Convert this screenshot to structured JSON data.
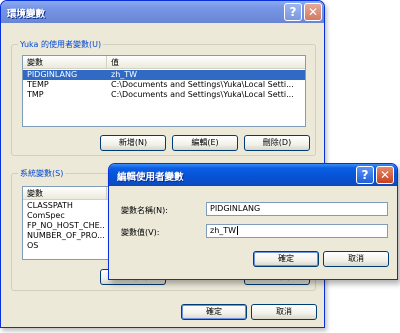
{
  "main_window": {
    "title": "環境變數",
    "help_icon_glyph": "?",
    "close_icon_glyph": "✕",
    "user_vars": {
      "group_label": "Yuka 的使用者變數(U)",
      "col_variable": "變數",
      "col_value": "值",
      "rows": [
        {
          "name": "PIDGINLANG",
          "value": "zh_TW"
        },
        {
          "name": "TEMP",
          "value": "C:\\Documents and Settings\\Yuka\\Local Setti..."
        },
        {
          "name": "TMP",
          "value": "C:\\Documents and Settings\\Yuka\\Local Setti..."
        }
      ],
      "new_label": "新增(N)",
      "edit_label": "編輯(E)",
      "delete_label": "刪除(D)"
    },
    "system_vars": {
      "group_label": "系統變數(S)",
      "col_variable": "變數",
      "rows": [
        "CLASSPATH",
        "ComSpec",
        "FP_NO_HOST_CHE...",
        "NUMBER_OF_PRO...",
        "OS"
      ],
      "new_label": "新增(W)",
      "delete_label": "刪除(L)"
    },
    "ok_label": "確定",
    "cancel_label": "取消"
  },
  "edit_dialog": {
    "title": "編輯使用者變數",
    "help_icon_glyph": "?",
    "close_icon_glyph": "✕",
    "name_label": "變數名稱(N):",
    "name_value": "PIDGINLANG",
    "value_label": "變數值(V):",
    "value_value": "zh_TW",
    "ok_label": "確定",
    "cancel_label": "取消"
  },
  "colors": {
    "selection": "#316ac5",
    "titlebar": "#0653d6",
    "group_label": "#0046d5"
  }
}
